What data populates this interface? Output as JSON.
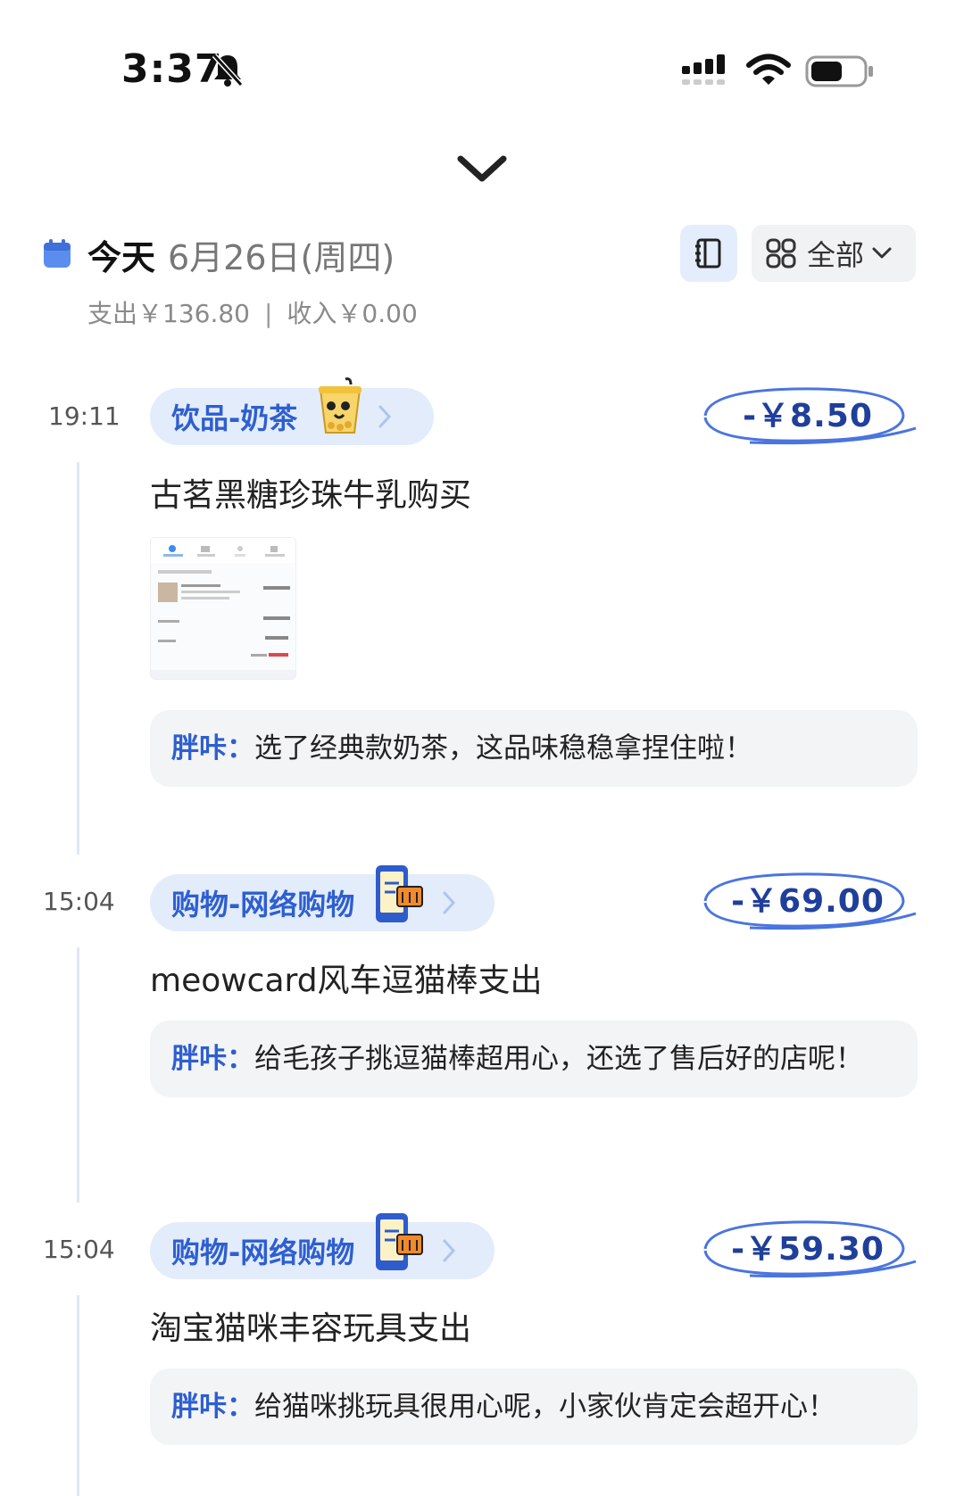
{
  "status_bar": {
    "time": "3:37",
    "icons": [
      "bell-slash-icon",
      "cellular-signal-icon",
      "wifi-icon",
      "battery-icon"
    ]
  },
  "header": {
    "today_label": "今天",
    "date": "6月26日(周四)",
    "expense": "支出￥136.80",
    "separator": "|",
    "income": "收入￥0.00",
    "filter_label": "全部"
  },
  "colors": {
    "accent": "#2e5fd0",
    "pill_bg": "#e3ecfb",
    "amount": "#1f3f9a",
    "comment_bg": "#f3f4f6"
  },
  "entries": [
    {
      "time": "19:11",
      "category": "饮品-奶茶",
      "category_icon": "bubble-tea-icon",
      "amount": "-￥8.50",
      "title": "古茗黑糖珍珠牛乳购买",
      "comment_author": "胖咔：",
      "comment_text": "选了经典款奶茶，这品味稳稳拿捏住啦！",
      "has_attachment": true
    },
    {
      "time": "15:04",
      "category": "购物-网络购物",
      "category_icon": "phone-shopping-icon",
      "amount": "-￥69.00",
      "title": "meowcard风车逗猫棒支出",
      "comment_author": "胖咔：",
      "comment_text": "给毛孩子挑逗猫棒超用心，还选了售后好的店呢！"
    },
    {
      "time": "15:04",
      "category": "购物-网络购物",
      "category_icon": "phone-shopping-icon",
      "amount": "-￥59.30",
      "title": "淘宝猫咪丰容玩具支出",
      "comment_author": "胖咔：",
      "comment_text": "给猫咪挑玩具很用心呢，小家伙肯定会超开心！"
    }
  ]
}
